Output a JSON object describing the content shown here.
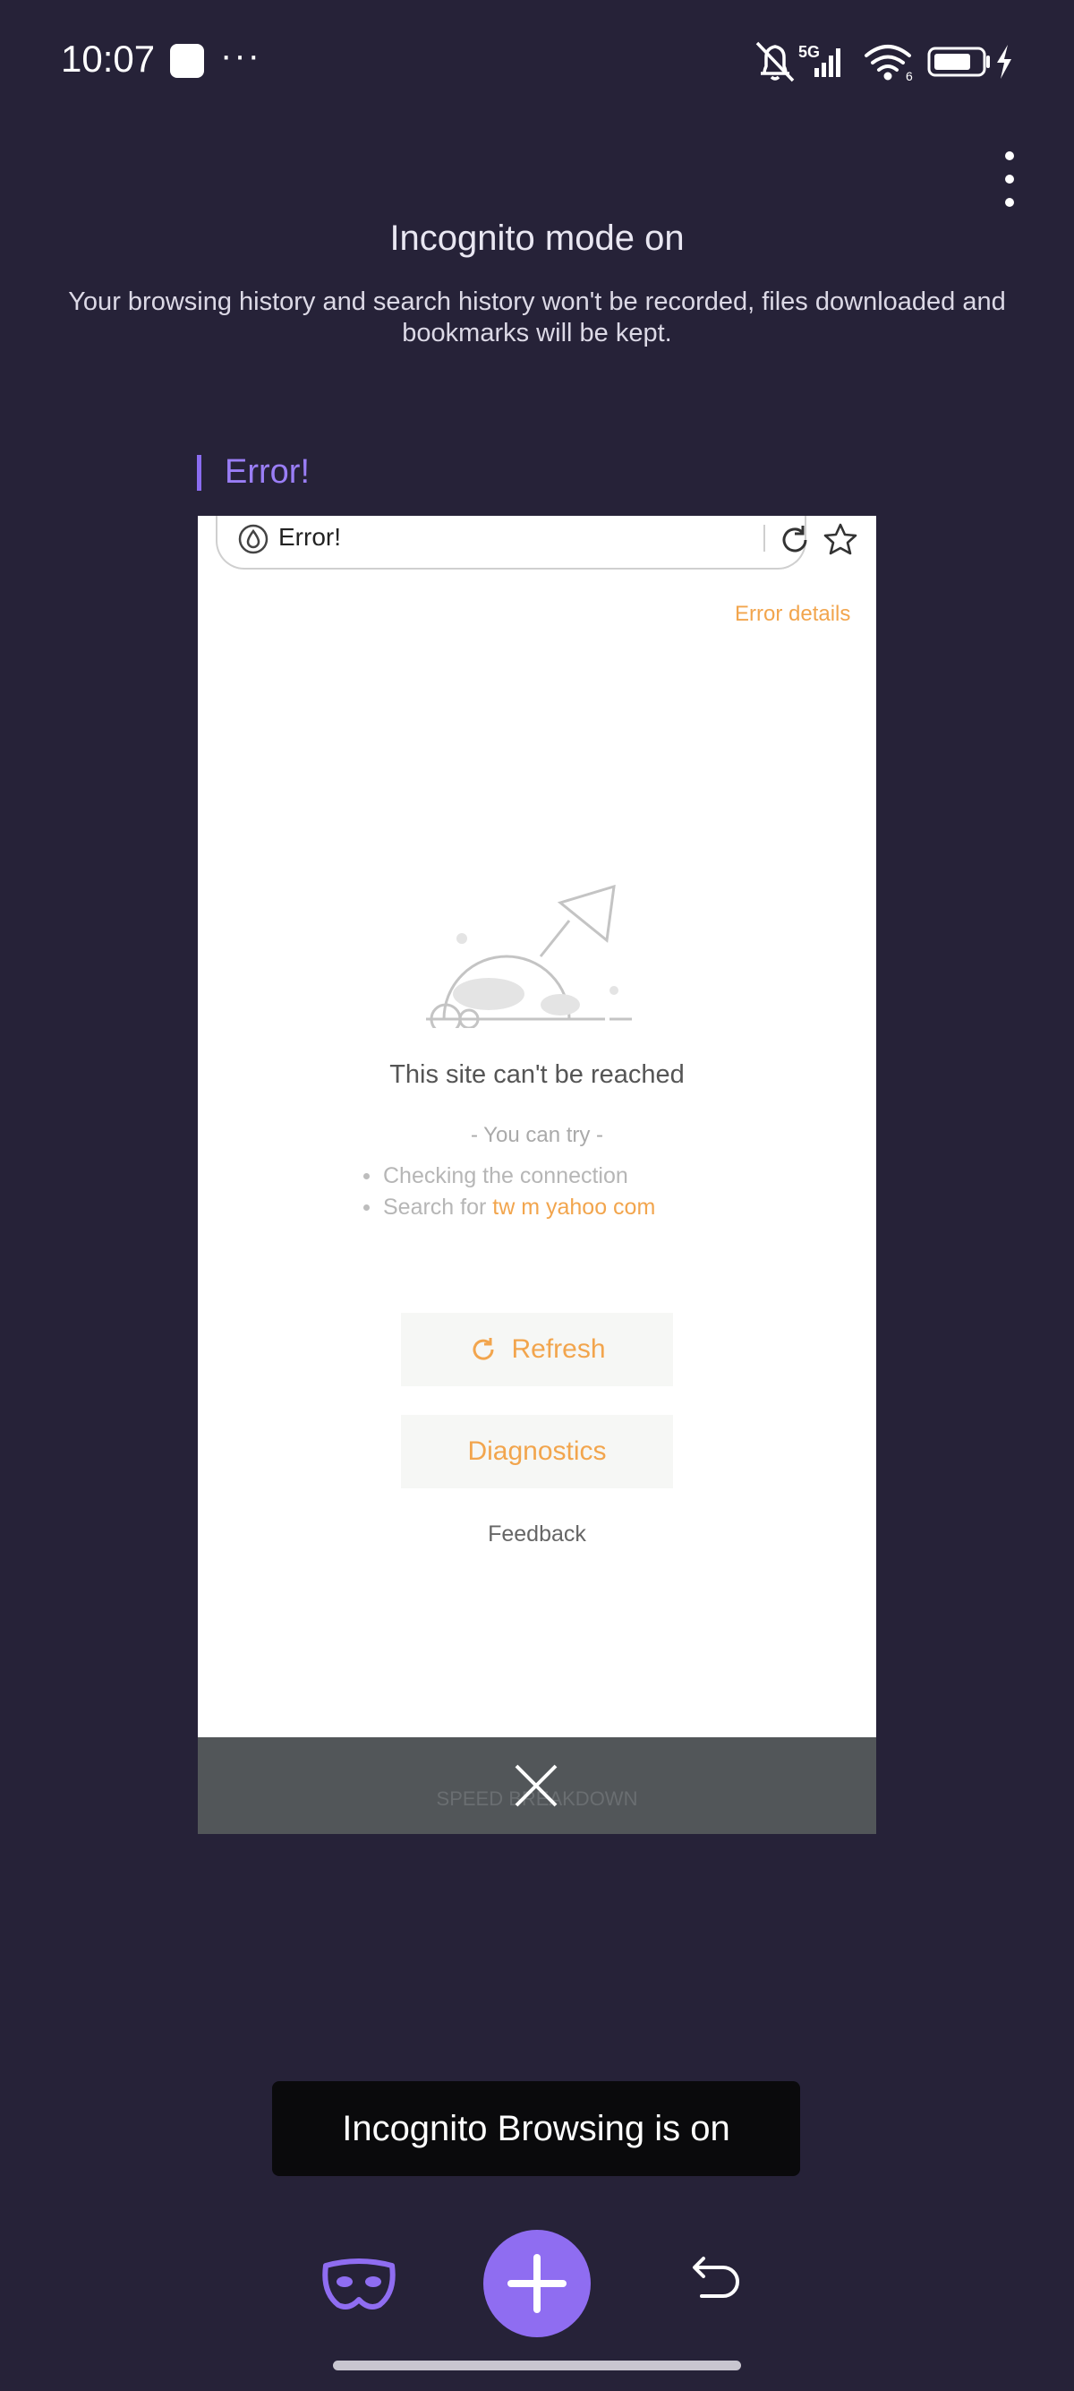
{
  "status_bar": {
    "time": "10:07",
    "overflow_dots": "···",
    "network": "5G",
    "wifi_badge": "6",
    "icons": [
      "notification-square-icon",
      "bell-muted-icon",
      "signal-icon",
      "wifi-icon",
      "battery-icon",
      "charging-icon"
    ]
  },
  "incognito": {
    "title": "Incognito mode on",
    "description": "Your browsing history and search history won't be recorded, files downloaded and bookmarks will be kept."
  },
  "tab": {
    "label": "Error!",
    "accent": "#8a6cf0",
    "address_bar": {
      "text": "Error!"
    },
    "page": {
      "error_details": "Error details",
      "title": "This site can't be reached",
      "try_heading": "- You can try -",
      "tips": [
        {
          "text": "Checking the connection",
          "highlight": ""
        },
        {
          "text": "Search for ",
          "highlight": "tw m yahoo com"
        }
      ],
      "refresh_label": "Refresh",
      "diagnostics_label": "Diagnostics",
      "feedback_label": "Feedback",
      "accent": "#f2a54d"
    },
    "close_bar_ghost_text": "SPEED BREAKDOWN"
  },
  "toast": {
    "text": "Incognito Browsing is on"
  },
  "bottom_bar": {
    "fab_color": "#8f6df1",
    "icons": [
      "incognito-mask-icon",
      "plus-icon",
      "undo-icon"
    ]
  }
}
